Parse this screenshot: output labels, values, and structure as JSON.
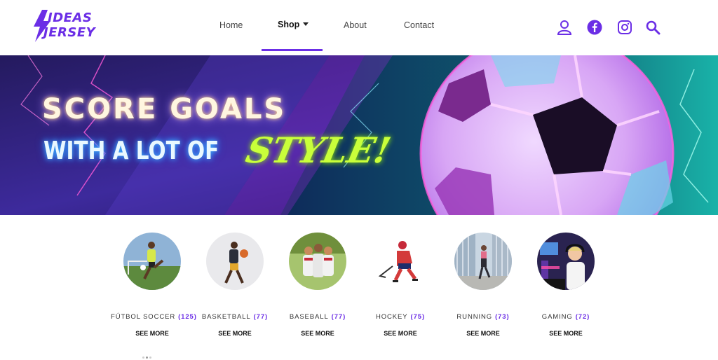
{
  "brand": {
    "line1": "IDEAS",
    "line2": "JERSEY",
    "color": "#6b2ee6"
  },
  "nav": {
    "items": [
      {
        "label": "Home",
        "active": false
      },
      {
        "label": "Shop",
        "active": true,
        "has_dropdown": true
      },
      {
        "label": "About",
        "active": false
      },
      {
        "label": "Contact",
        "active": false
      }
    ]
  },
  "header_icons": [
    "user-icon",
    "facebook-icon",
    "instagram-icon",
    "search-icon"
  ],
  "banner": {
    "line1": "SCORE GOALS",
    "line2": "WITH A LOT OF",
    "highlight": "STYLE!"
  },
  "categories": [
    {
      "name": "FÚTBOL SOCCER",
      "count": "(125)",
      "link": "SEE MORE",
      "icon": "soccer-player-image"
    },
    {
      "name": "BASKETBALL",
      "count": "(77)",
      "link": "SEE MORE",
      "icon": "basketball-player-image"
    },
    {
      "name": "BASEBALL",
      "count": "(77)",
      "link": "SEE MORE",
      "icon": "baseball-team-image"
    },
    {
      "name": "HOCKEY",
      "count": "(75)",
      "link": "SEE MORE",
      "icon": "hockey-player-image"
    },
    {
      "name": "RUNNING",
      "count": "(73)",
      "link": "SEE MORE",
      "icon": "runner-image"
    },
    {
      "name": "GAMING",
      "count": "(72)",
      "link": "SEE MORE",
      "icon": "gamer-image"
    }
  ],
  "colors": {
    "accent": "#6b2ee6",
    "highlight": "#c9ff3a"
  }
}
